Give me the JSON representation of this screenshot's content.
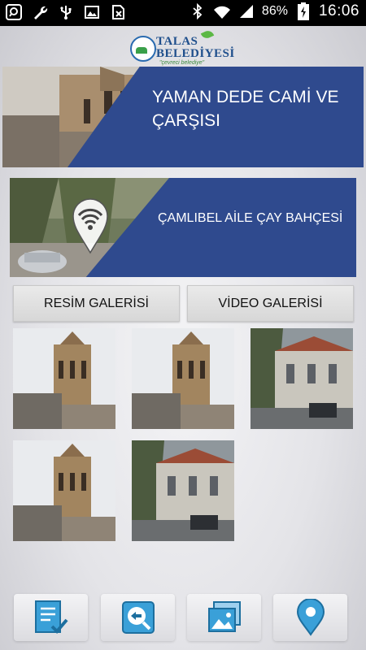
{
  "status_bar": {
    "battery_percent": "86%",
    "time": "16:06",
    "left_icons": [
      "search-app-icon",
      "wrench-icon",
      "usb-icon",
      "image-icon",
      "sim-icon"
    ],
    "right_icons": [
      "bluetooth-icon",
      "wifi-icon",
      "signal-icon",
      "battery-charging-icon"
    ]
  },
  "logo": {
    "title_line1": "TALAS",
    "title_line2": "BELEDİYESİ",
    "tagline": "\"çevreci belediye\""
  },
  "banners": [
    {
      "title": "YAMAN DEDE CAMİ VE ÇARŞISI",
      "accent": "#2f4a8e"
    },
    {
      "title": "ÇAMLIBEL AİLE ÇAY BAHÇESİ",
      "accent": "#2f4a8e",
      "badge_icon": "wifi-location-pin-icon"
    }
  ],
  "gallery_buttons": {
    "photo_gallery": "RESİM GALERİSİ",
    "video_gallery": "VİDEO GALERİSİ"
  },
  "thumbnails": [
    {
      "subject": "mosque"
    },
    {
      "subject": "mosque"
    },
    {
      "subject": "building"
    },
    {
      "subject": "mosque"
    },
    {
      "subject": "building"
    }
  ],
  "bottom_nav": [
    {
      "icon": "checklist-icon"
    },
    {
      "icon": "directions-icon"
    },
    {
      "icon": "photos-icon"
    },
    {
      "icon": "location-pin-icon"
    }
  ]
}
